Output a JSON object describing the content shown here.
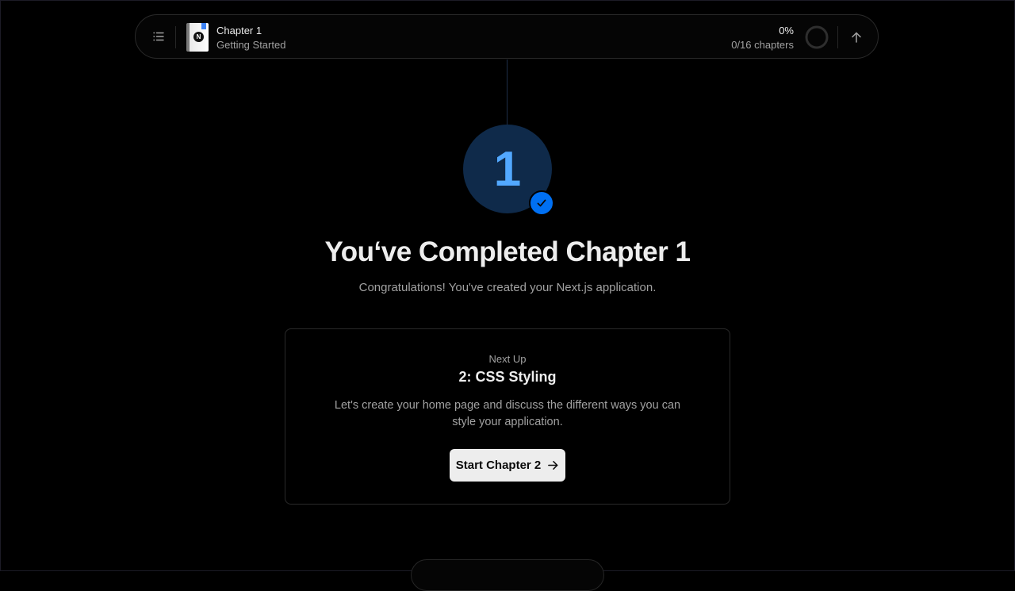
{
  "topbar": {
    "menu_icon": "list-icon",
    "chapter_title": "Chapter 1",
    "chapter_subtitle": "Getting Started",
    "progress_percent": "0%",
    "progress_count": "0/16 chapters",
    "progress_value": 0,
    "up_icon": "arrow-up-icon"
  },
  "completion": {
    "badge_number": "1",
    "headline": "You‘ve Completed Chapter 1",
    "subline": "Congratulations! You've created your Next.js application."
  },
  "next_card": {
    "label": "Next Up",
    "title": "2: CSS Styling",
    "description": "Let's create your home page and discuss the different ways you can style your application.",
    "button_label": "Start Chapter 2",
    "button_icon": "arrow-right-icon"
  },
  "colors": {
    "badge_bg": "#0f2a4a",
    "badge_text": "#52a8ff",
    "check_bg": "#0070f3",
    "button_bg": "#ededed"
  }
}
